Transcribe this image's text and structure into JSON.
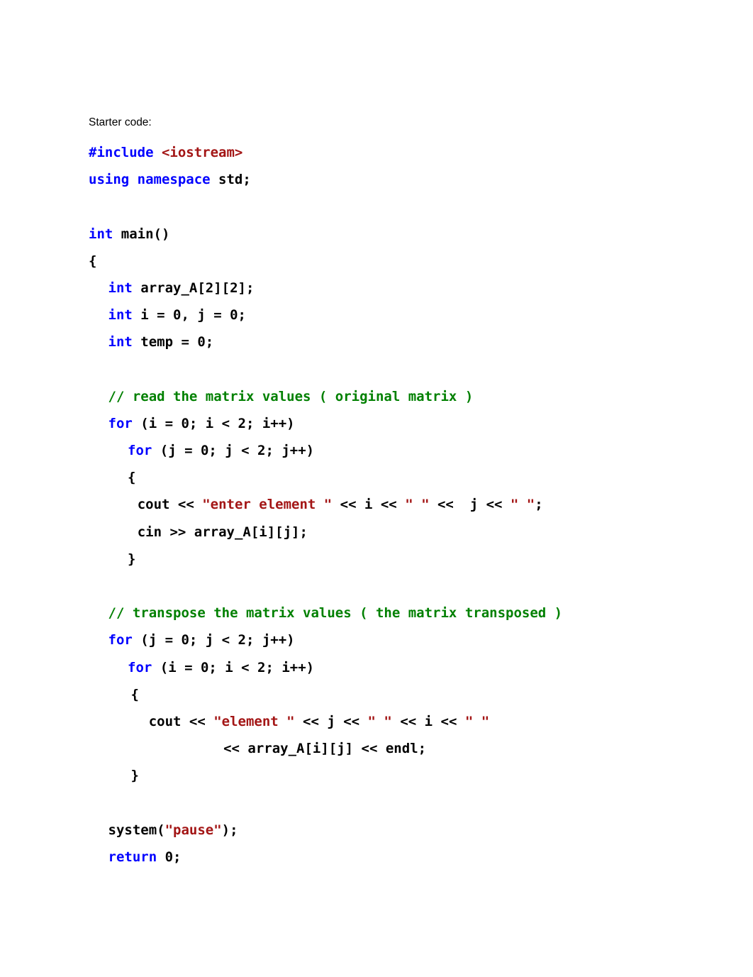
{
  "document": {
    "intro_label": "Starter code:",
    "language": "C++",
    "colors": {
      "keyword": "#0000FF",
      "string": "#A31515",
      "comment": "#008000",
      "identifier": "#000000",
      "background": "#FFFFFF"
    }
  },
  "code": {
    "lines": [
      {
        "id": "line-include",
        "indent": 0,
        "tokens": [
          {
            "t": "pre",
            "v": "#include "
          },
          {
            "t": "inc",
            "v": "<iostream>"
          }
        ]
      },
      {
        "id": "line-using-namespace",
        "indent": 0,
        "tokens": [
          {
            "t": "kw",
            "v": "using namespace "
          },
          {
            "t": "id",
            "v": "std;"
          }
        ]
      },
      {
        "id": "line-blank-1",
        "indent": 0,
        "tokens": []
      },
      {
        "id": "line-int-main",
        "indent": 0,
        "tokens": [
          {
            "t": "kw",
            "v": "int "
          },
          {
            "t": "id",
            "v": "main()"
          }
        ]
      },
      {
        "id": "line-open-brace-main",
        "indent": 0,
        "tokens": [
          {
            "t": "id",
            "v": "{"
          }
        ]
      },
      {
        "id": "line-decl-array",
        "indent": 1.2,
        "tokens": [
          {
            "t": "kw",
            "v": "int "
          },
          {
            "t": "id",
            "v": "array_A[2][2];"
          }
        ]
      },
      {
        "id": "line-decl-i-j",
        "indent": 1.2,
        "tokens": [
          {
            "t": "kw",
            "v": "int "
          },
          {
            "t": "id",
            "v": "i = 0, j = 0;"
          }
        ]
      },
      {
        "id": "line-decl-temp",
        "indent": 1.2,
        "tokens": [
          {
            "t": "kw",
            "v": "int "
          },
          {
            "t": "id",
            "v": "temp = 0;"
          }
        ]
      },
      {
        "id": "line-blank-2",
        "indent": 0,
        "tokens": []
      },
      {
        "id": "line-comment-read",
        "indent": 1.2,
        "tokens": [
          {
            "t": "com",
            "v": "// read the matrix values ( original matrix )"
          }
        ]
      },
      {
        "id": "line-for-i-outer",
        "indent": 1.2,
        "tokens": [
          {
            "t": "kw",
            "v": "for"
          },
          {
            "t": "id",
            "v": " (i = 0; i < 2; i++)"
          }
        ]
      },
      {
        "id": "line-for-j-inner",
        "indent": 2.4,
        "tokens": [
          {
            "t": "kw",
            "v": "for"
          },
          {
            "t": "id",
            "v": " (j = 0; j < 2; j++)"
          }
        ]
      },
      {
        "id": "line-open-brace-read",
        "indent": 2.4,
        "tokens": [
          {
            "t": "id",
            "v": "{"
          }
        ]
      },
      {
        "id": "line-cout-enter-element",
        "indent": 3.0,
        "tokens": [
          {
            "t": "id",
            "v": "cout << "
          },
          {
            "t": "str",
            "v": "\"enter element \""
          },
          {
            "t": "id",
            "v": " << i << "
          },
          {
            "t": "str",
            "v": "\" \""
          },
          {
            "t": "id",
            "v": " <<  j << "
          },
          {
            "t": "str",
            "v": "\" \""
          },
          {
            "t": "id",
            "v": ";"
          }
        ]
      },
      {
        "id": "line-cin-array",
        "indent": 3.0,
        "tokens": [
          {
            "t": "id",
            "v": "cin >> array_A[i][j];"
          }
        ]
      },
      {
        "id": "line-close-brace-read",
        "indent": 2.4,
        "tokens": [
          {
            "t": "id",
            "v": "}"
          }
        ]
      },
      {
        "id": "line-blank-3",
        "indent": 0,
        "tokens": []
      },
      {
        "id": "line-comment-transpose",
        "indent": 1.2,
        "tokens": [
          {
            "t": "com",
            "v": "// transpose the matrix values ( the matrix transposed )"
          }
        ]
      },
      {
        "id": "line-for-j-outer",
        "indent": 1.2,
        "tokens": [
          {
            "t": "kw",
            "v": "for"
          },
          {
            "t": "id",
            "v": " (j = 0; j < 2; j++)"
          }
        ]
      },
      {
        "id": "line-for-i-inner",
        "indent": 2.4,
        "tokens": [
          {
            "t": "kw",
            "v": "for"
          },
          {
            "t": "id",
            "v": " (i = 0; i < 2; i++)"
          }
        ]
      },
      {
        "id": "line-open-brace-transpose",
        "indent": 2.6,
        "tokens": [
          {
            "t": "id",
            "v": "{"
          }
        ]
      },
      {
        "id": "line-cout-element",
        "indent": 3.7,
        "tokens": [
          {
            "t": "id",
            "v": "cout << "
          },
          {
            "t": "str",
            "v": "\"element \""
          },
          {
            "t": "id",
            "v": " << j << "
          },
          {
            "t": "str",
            "v": "\" \""
          },
          {
            "t": "id",
            "v": " << i << "
          },
          {
            "t": "str",
            "v": "\" \""
          }
        ]
      },
      {
        "id": "line-cout-array-endl",
        "indent": 8.3,
        "tokens": [
          {
            "t": "id",
            "v": "<< array_A[i][j] << endl;"
          }
        ]
      },
      {
        "id": "line-close-brace-transpose",
        "indent": 2.6,
        "tokens": [
          {
            "t": "id",
            "v": "}"
          }
        ]
      },
      {
        "id": "line-blank-4",
        "indent": 0,
        "tokens": []
      },
      {
        "id": "line-system-pause",
        "indent": 1.2,
        "tokens": [
          {
            "t": "id",
            "v": "system("
          },
          {
            "t": "str",
            "v": "\"pause\""
          },
          {
            "t": "id",
            "v": ");"
          }
        ]
      },
      {
        "id": "line-return-zero",
        "indent": 1.2,
        "tokens": [
          {
            "t": "kw",
            "v": "return "
          },
          {
            "t": "id",
            "v": "0;"
          }
        ]
      }
    ]
  }
}
